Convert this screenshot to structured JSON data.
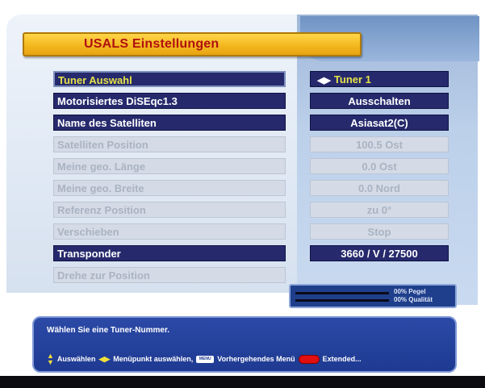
{
  "header": {
    "title": "USALS Einstellungen"
  },
  "settings": {
    "rows": [
      {
        "label": "Tuner Auswahl",
        "value": "Tuner 1",
        "state": "selected"
      },
      {
        "label": "Motorisiertes DiSEqc1.3",
        "value": "Ausschalten",
        "state": "active"
      },
      {
        "label": "Name des Satelliten",
        "value": "Asiasat2(C)",
        "state": "active"
      },
      {
        "label": "Satelliten Position",
        "value": "100.5 Ost",
        "state": "disabled"
      },
      {
        "label": "Meine geo. Länge",
        "value": "0.0 Ost",
        "state": "disabled"
      },
      {
        "label": "Meine geo. Breite",
        "value": "0.0 Nord",
        "state": "disabled"
      },
      {
        "label": "Referenz Position",
        "value": "zu 0°",
        "state": "disabled"
      },
      {
        "label": "Verschieben",
        "value": "Stop",
        "state": "disabled"
      },
      {
        "label": "Transponder",
        "value": "3660 / V / 27500",
        "state": "active"
      },
      {
        "label": "Drehe zur Position",
        "value": "",
        "state": "disabled"
      }
    ]
  },
  "signal": {
    "level_label": "00% Pegel",
    "quality_label": "00% Qualität",
    "level": 0,
    "quality": 0
  },
  "help": {
    "message": "Wählen Sie eine Tuner-Nummer.",
    "select_label": "Auswählen",
    "menu_item_label": "Menüpunkt auswählen,",
    "menu_key_label": "MENU",
    "previous_menu_label": "Vorhergehendes Menü",
    "extended_label": "Extended..."
  },
  "colors": {
    "title_bar": "#f3b81e",
    "title_text": "#b01010",
    "row_active": "#262a6c",
    "row_disabled": "#d4dbe6",
    "selected_text": "#e7e24a",
    "help_bg": "#1e3a92",
    "red_key": "#e10f0f"
  },
  "icons": {
    "left_right": "left-right-arrows-icon",
    "up_down": "up-down-arrows-icon",
    "red_button": "red-button-icon"
  }
}
